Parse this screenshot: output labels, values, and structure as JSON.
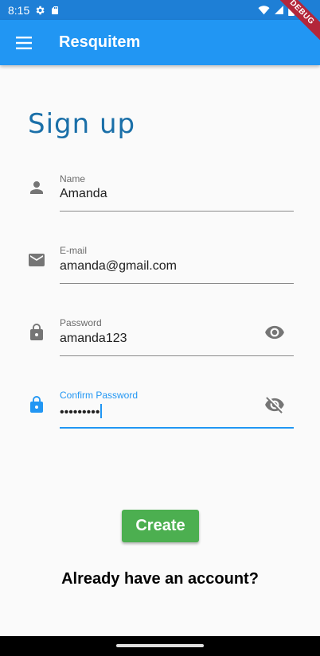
{
  "status_bar": {
    "time": "8:15",
    "icons": [
      "settings-gear-icon",
      "sd-card-icon",
      "wifi-icon",
      "cell-signal-icon",
      "battery-icon"
    ]
  },
  "app_bar": {
    "title": "Resquitem",
    "menu_icon": "hamburger-menu-icon",
    "debug_banner": "DEBUG"
  },
  "page": {
    "title": "Sign up"
  },
  "form": {
    "name": {
      "label": "Name",
      "value": "Amanda",
      "icon": "person-icon"
    },
    "email": {
      "label": "E-mail",
      "value": "amanda@gmail.com",
      "icon": "mail-icon"
    },
    "password": {
      "label": "Password",
      "value": "amanda123",
      "icon": "lock-icon",
      "toggle_icon": "eye-icon"
    },
    "confirm_password": {
      "label": "Confirm Password",
      "value": "•••••••••",
      "icon": "lock-icon",
      "toggle_icon": "eye-off-icon"
    }
  },
  "actions": {
    "create_label": "Create",
    "login_link": "Already have an account?"
  },
  "colors": {
    "primary": "#2196f3",
    "status_bar": "#1e7fd6",
    "title": "#1a6fa8",
    "button": "#4caf50",
    "icon_grey": "#757575"
  }
}
